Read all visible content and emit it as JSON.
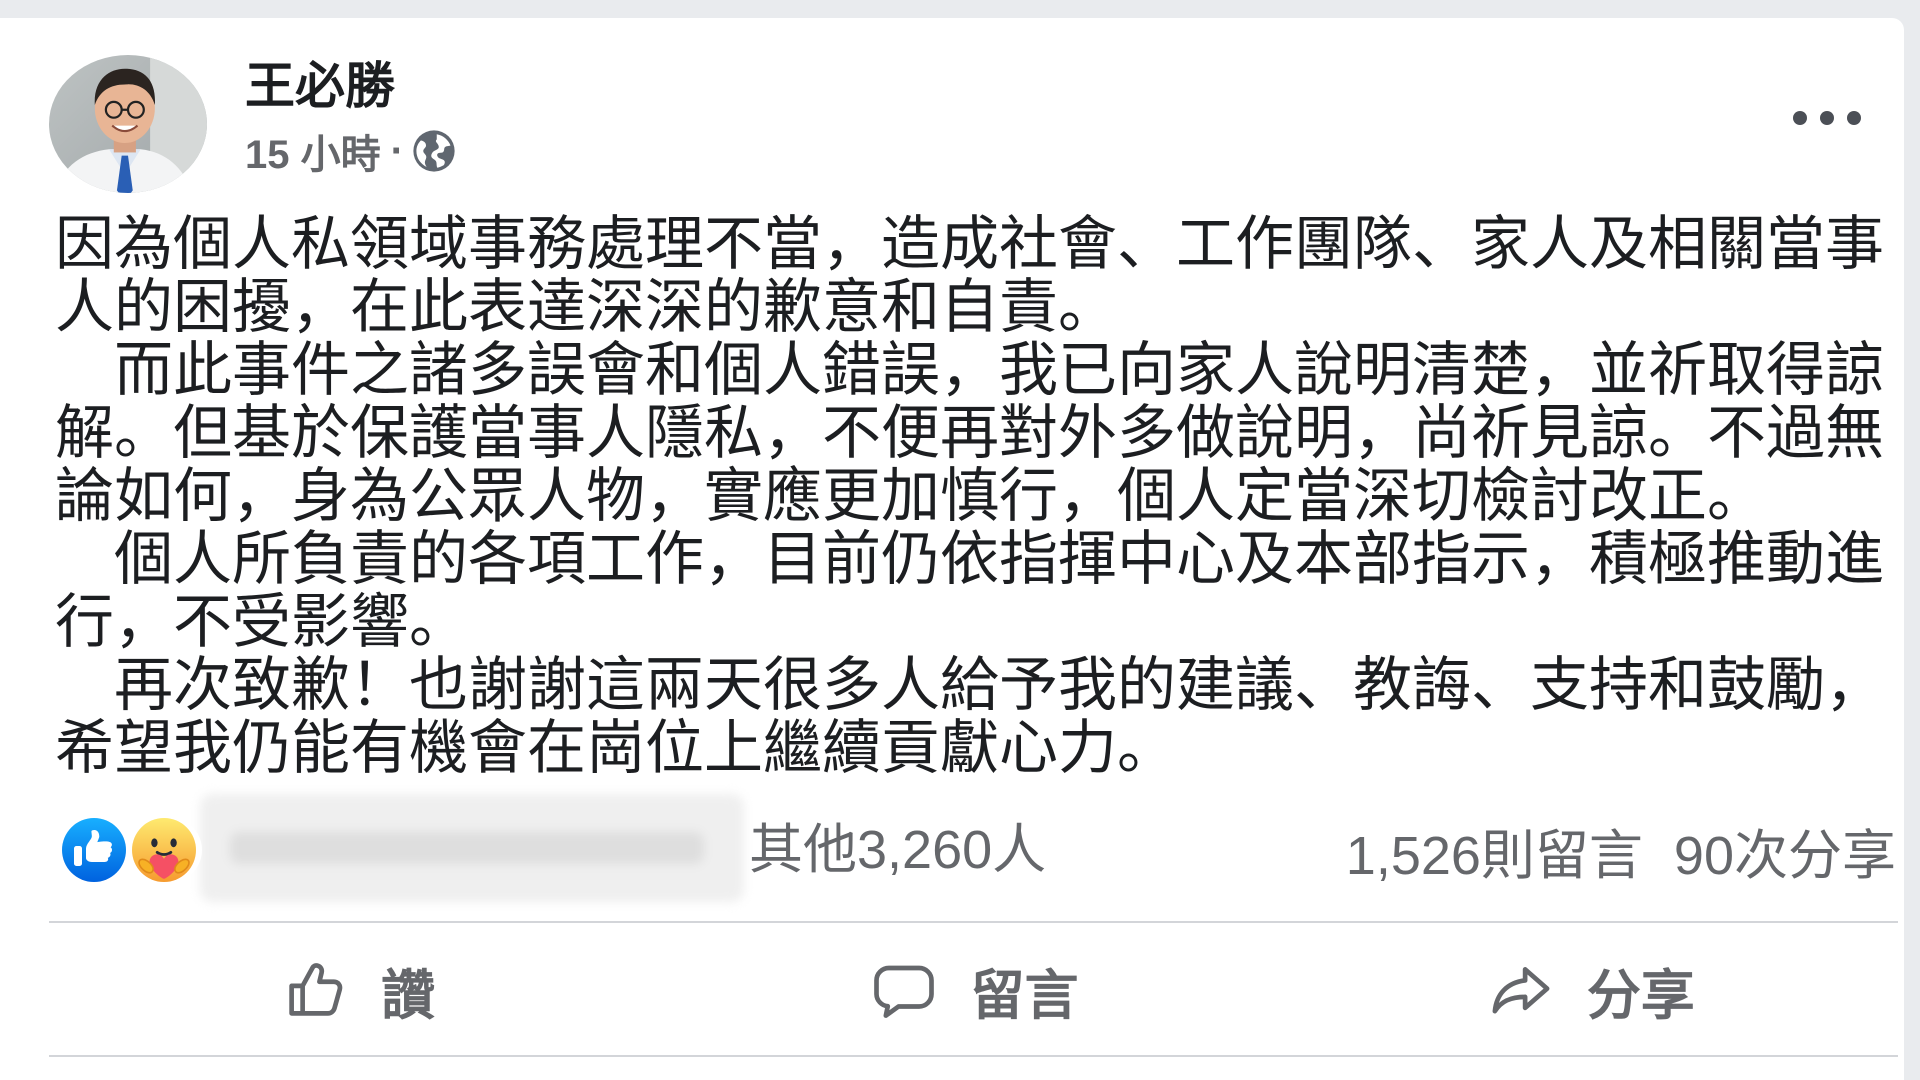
{
  "post": {
    "author": {
      "name": "王必勝",
      "avatar_icon": "profile-photo"
    },
    "timestamp": "15 小時",
    "separator": "·",
    "privacy_icon": "globe-icon",
    "more_icon": "more-options-icon",
    "paragraphs": [
      "因為個人私領域事務處理不當，造成社會、工作團隊、家人及相關當事人的困擾，在此表達深深的歉意和自責。",
      "而此事件之諸多誤會和個人錯誤，我已向家人說明清楚，並祈取得諒解。但基於保護當事人隱私，不便再對外多做說明，尚祈見諒。不過無論如何，身為公眾人物，實應更加慎行，個人定當深切檢討改正。",
      "個人所負責的各項工作，目前仍依指揮中心及本部指示，積極推動進行，不受影響。",
      "再次致歉！也謝謝這兩天很多人給予我的建議、教誨、支持和鼓勵，希望我仍能有機會在崗位上繼續貢獻心力。"
    ]
  },
  "reactions": {
    "icons": [
      "like-reaction-icon",
      "care-reaction-icon"
    ],
    "count_text": "其他3,260人",
    "comments": "1,526則留言",
    "shares": "90次分享"
  },
  "actions": [
    {
      "label": "讚",
      "icon": "thumbs-up-icon"
    },
    {
      "label": "留言",
      "icon": "comment-icon"
    },
    {
      "label": "分享",
      "icon": "share-icon"
    }
  ],
  "colors": {
    "page_background": "#e9ebee",
    "card_background": "#ffffff",
    "text_primary": "#1c1e21",
    "text_secondary": "#65676b",
    "like_blue": "#1877f2",
    "care_yellow": "#f7b125",
    "heart_red": "#f55064",
    "divider": "#d3d5d9"
  }
}
